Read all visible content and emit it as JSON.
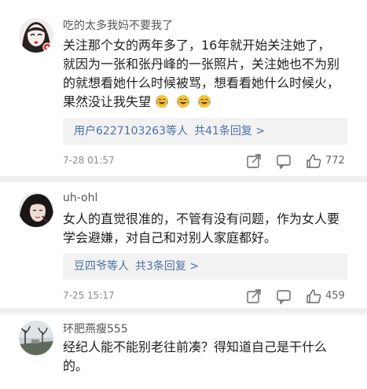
{
  "comments": [
    {
      "username": "吃的太多我妈不要我了",
      "lines": [
        "关注那个女的两年多了，16年就开始关注她了，",
        "就因为一张和张丹峰的一张照片，关注她也不为别",
        "的就想看她什么时候被骂，想看看她什么时候火，",
        "果然没让我失望"
      ],
      "emoji_name": "laughing-crying-emoji",
      "reply": {
        "users": "用户6227103263等人",
        "count": "共41条回复 >"
      },
      "time": "7-28 01:57",
      "likes": "772",
      "icons": [
        "share-icon",
        "comment-icon",
        "like-icon"
      ]
    },
    {
      "username": "uh-ohl",
      "lines": [
        "女人的直觉很准的，不管有没有问题，作为女人要",
        "学会避嫌，对自己和对别人家庭都好。"
      ],
      "reply": {
        "users": "豆四爷等人",
        "count": "共3条回复 >"
      },
      "time": "7-25 15:17",
      "likes": "459",
      "icons": [
        "share-icon",
        "comment-icon",
        "like-icon"
      ]
    },
    {
      "username": "环肥燕瘦555",
      "lines": [
        "经纪人能不能别老往前凑？得知道自己是干什么",
        "的。"
      ]
    }
  ],
  "colors": {
    "link_blue": "#4a72a8",
    "meta_gray": "#8a8a8a",
    "reply_bg": "#f2f2f2",
    "divider": "#efefef"
  }
}
